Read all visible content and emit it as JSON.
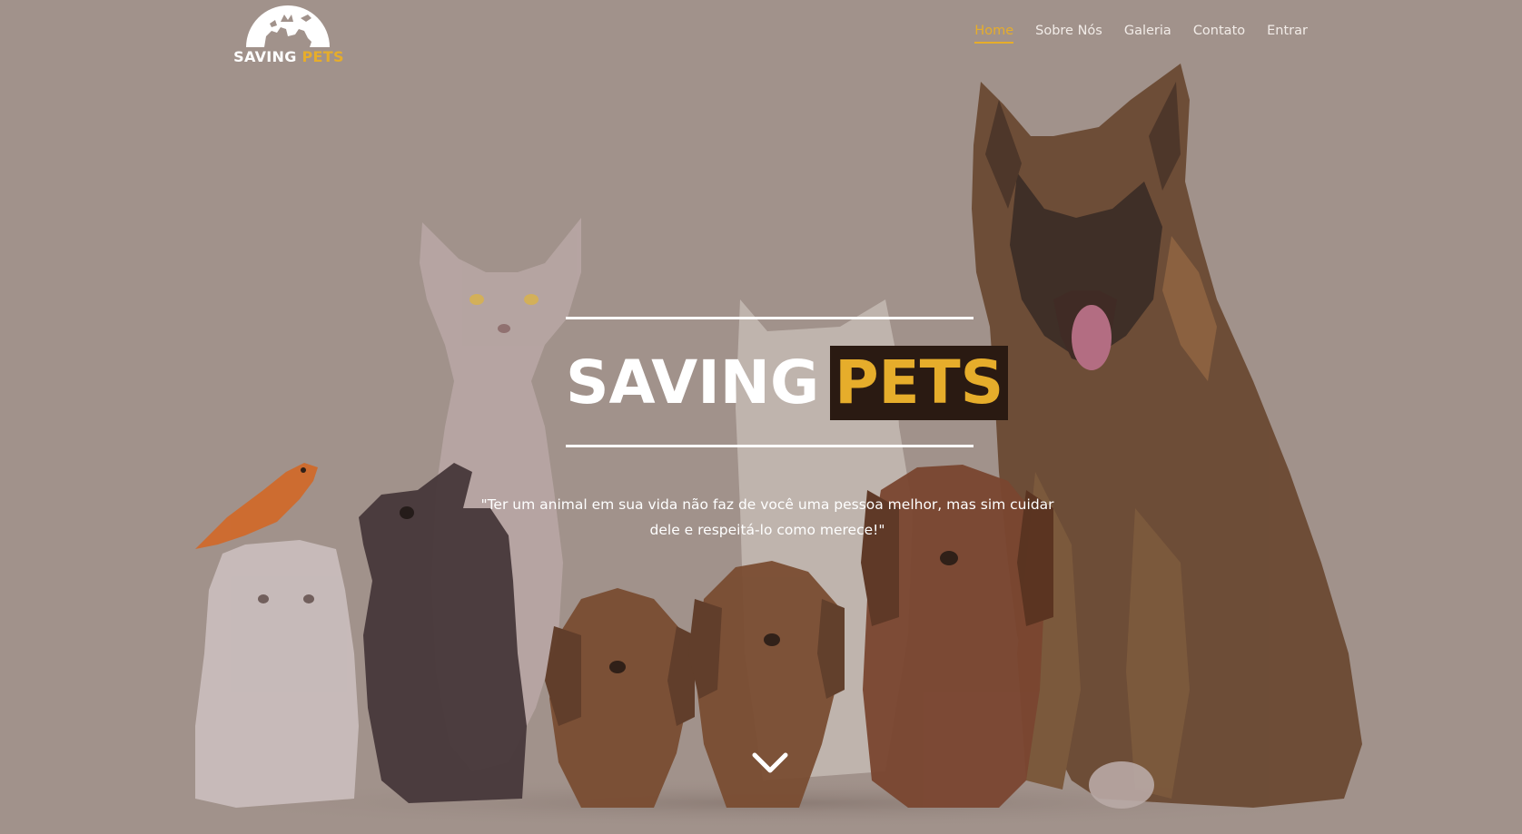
{
  "brand": {
    "logo_word1": "SAVING",
    "logo_word2": "PETS"
  },
  "nav": {
    "items": [
      {
        "label": "Home",
        "active": true
      },
      {
        "label": "Sobre Nós",
        "active": false
      },
      {
        "label": "Galeria",
        "active": false
      },
      {
        "label": "Contato",
        "active": false
      },
      {
        "label": "Entrar",
        "active": false
      }
    ]
  },
  "hero": {
    "title_word1": "SAVING",
    "title_word2": "PETS",
    "quote_line1": "\"Ter um animal em sua vida não faz de você uma pessoa melhor, mas sim cuidar",
    "quote_line2": "dele e respeitá-lo como merece!\"",
    "scroll_icon": "chevron-down-icon"
  },
  "colors": {
    "accent": "#e6ad2b",
    "overlay": "#a1928b",
    "title_highlight_bg": "#2a1a12",
    "text": "#ffffff"
  }
}
